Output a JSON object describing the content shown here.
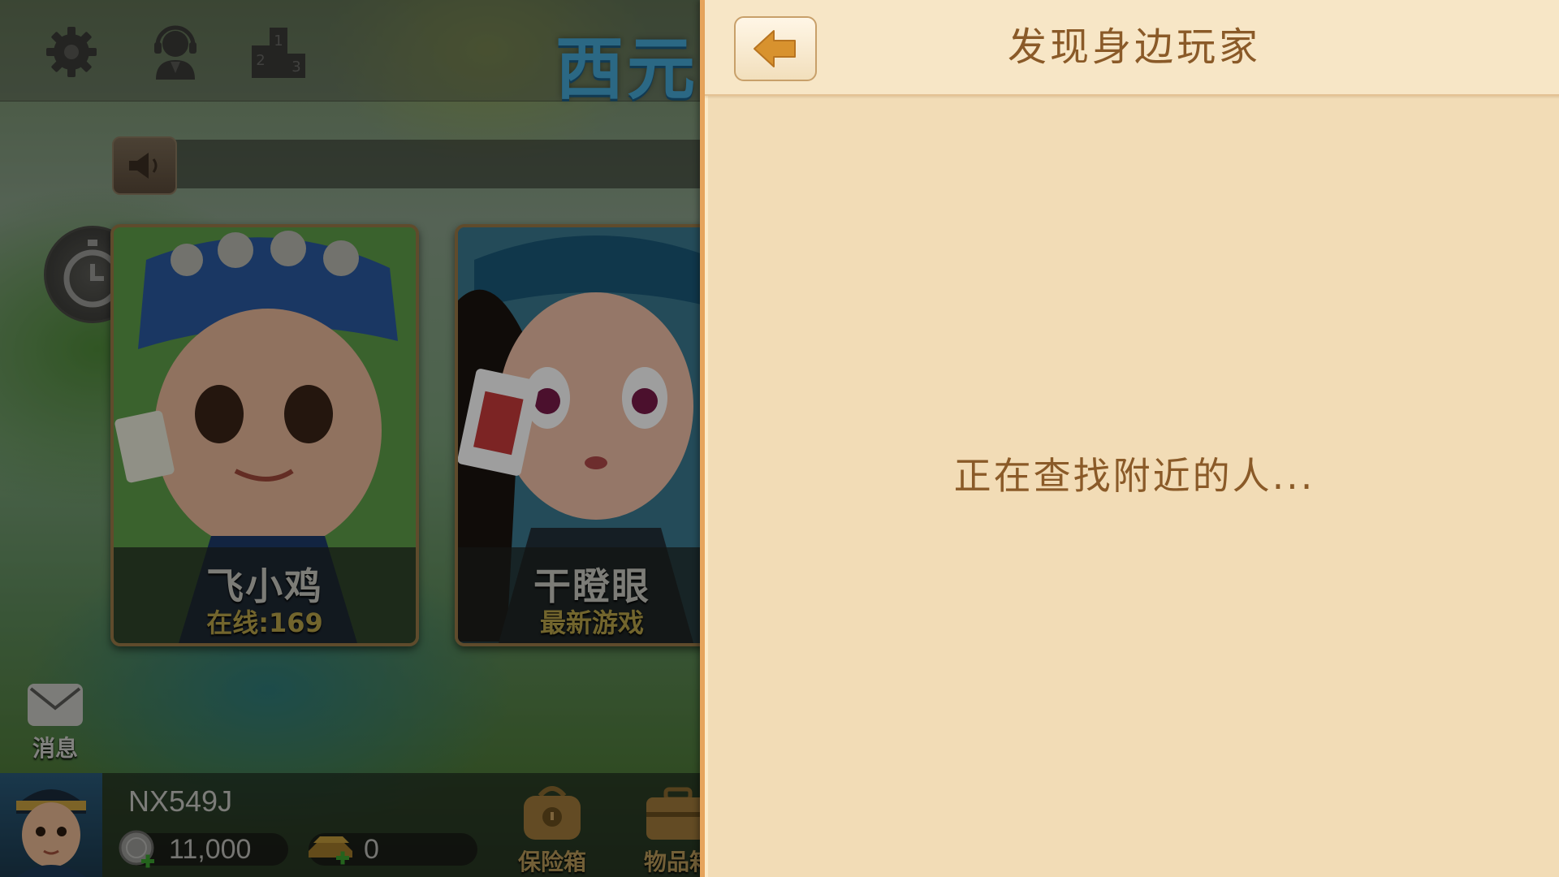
{
  "lobby": {
    "brand_title": "西元",
    "top_icons": [
      "gear-icon",
      "customer-service-icon",
      "leaderboard-icon"
    ],
    "leaderboard_ranks": [
      "1",
      "2",
      "3"
    ],
    "games": [
      {
        "name": "飞小鸡",
        "subtitle": "在线:169"
      },
      {
        "name": "干瞪眼",
        "subtitle": "最新游戏"
      }
    ],
    "message_label": "消息",
    "player": {
      "username": "NX549J",
      "silver_coins": "11,000",
      "gold_bars": "0"
    },
    "bottom_buttons": [
      {
        "label": "保险箱",
        "icon": "safe-box-icon"
      },
      {
        "label": "物品箱",
        "icon": "item-box-icon"
      }
    ]
  },
  "panel": {
    "title": "发现身边玩家",
    "back_icon": "back-arrow-icon",
    "status": "正在查找附近的人..."
  },
  "colors": {
    "panel_bg": "#f2dcb6",
    "panel_text": "#8a5a28",
    "accent_orange": "#e6a45c",
    "brand_blue": "#46a8d6"
  }
}
